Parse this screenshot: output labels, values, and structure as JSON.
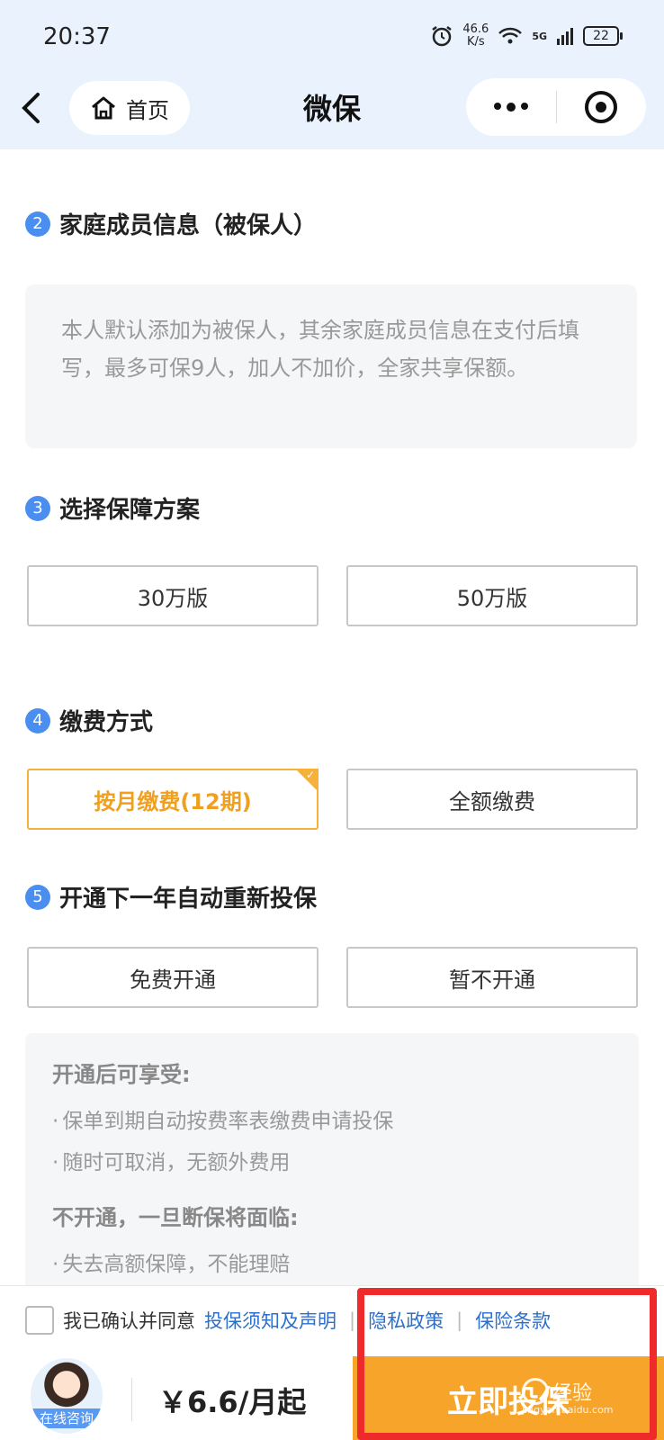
{
  "status": {
    "time": "20:37",
    "net_speed_value": "46.6",
    "net_speed_unit": "K/s",
    "network": "5G",
    "battery": "22"
  },
  "nav": {
    "home_label": "首页",
    "title": "微保"
  },
  "section2": {
    "number": "2",
    "title": "家庭成员信息（被保人）",
    "notice": "本人默认添加为被保人，其余家庭成员信息在支付后填写，最多可保9人，加人不加价，全家共享保额。"
  },
  "section3": {
    "number": "3",
    "title": "选择保障方案",
    "options": [
      "30万版",
      "50万版"
    ]
  },
  "section4": {
    "number": "4",
    "title": "缴费方式",
    "options": [
      "按月缴费(12期)",
      "全额缴费"
    ],
    "selected": "按月缴费(12期)"
  },
  "section5": {
    "number": "5",
    "title": "开通下一年自动重新投保",
    "options": [
      "免费开通",
      "暂不开通"
    ],
    "benefits_title": "开通后可享受:",
    "benefits": [
      "保单到期自动按费率表缴费申请投保",
      "随时可取消，无额外费用"
    ],
    "risks_title": "不开通，一旦断保将面临:",
    "risks": [
      "失去高额保障，不能理赔"
    ]
  },
  "footer": {
    "agree_text": "我已确认并同意",
    "links": [
      "投保须知及声明",
      "隐私政策",
      "保险条款"
    ],
    "consult_label": "在线咨询",
    "price": "￥6.6/月起",
    "buy_label": "立即投保",
    "watermark": "经验",
    "watermark_sub": "jingyan.baidu.com"
  },
  "colors": {
    "accent_blue": "#4a8ff0",
    "orange": "#f7a52a",
    "highlight_red": "#ee2a2a",
    "link_blue": "#2b6fcf"
  }
}
